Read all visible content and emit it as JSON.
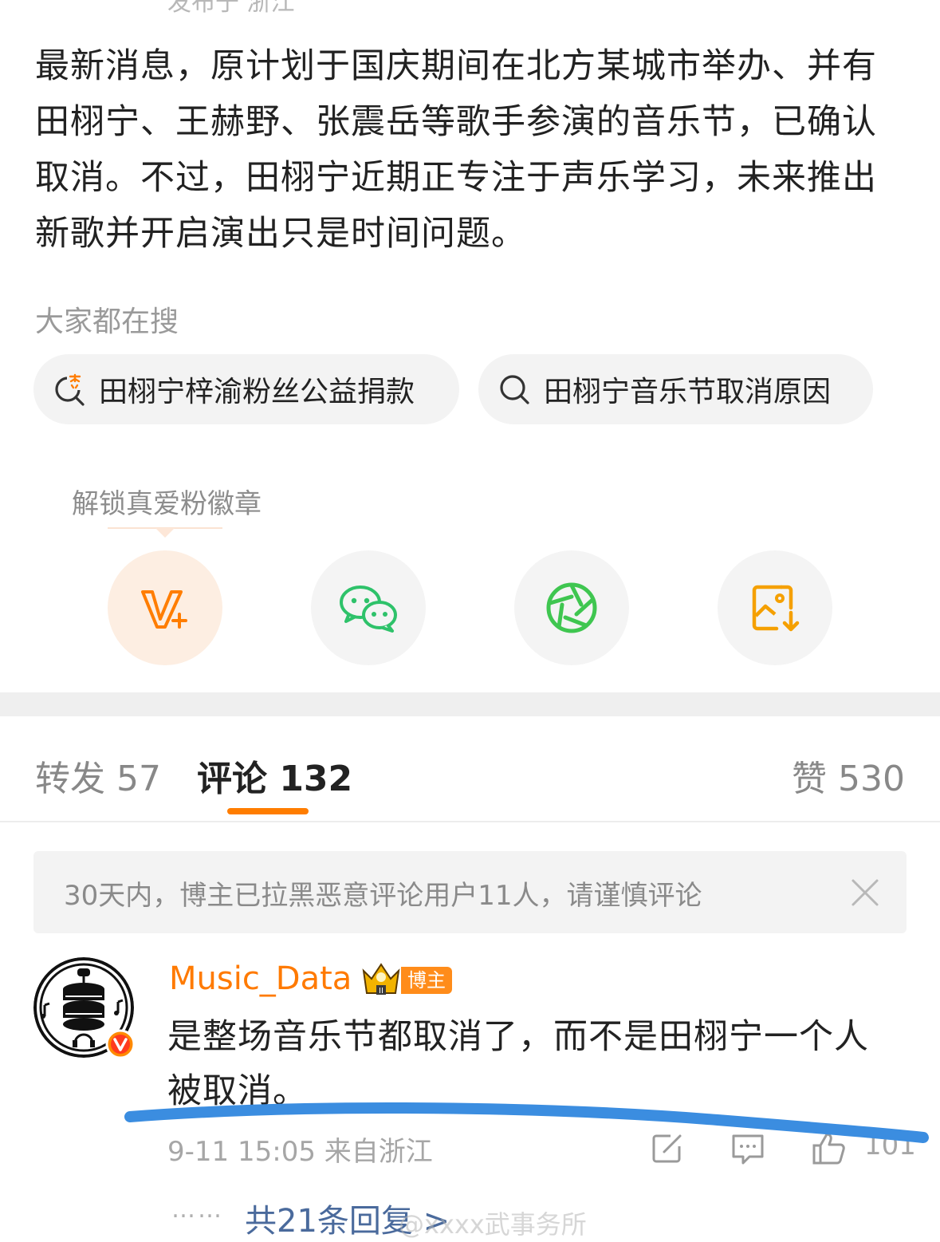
{
  "post": {
    "meta_cropped": "发布于 浙江",
    "body": "最新消息，原计划于国庆期间在北方某城市举办、并有田栩宁、王赫野、张震岳等歌手参演的音乐节，已确认取消。不过，田栩宁近期正专注于声乐学习，未来推出新歌并开启演出只是时间问题。"
  },
  "hot_search": {
    "title": "大家都在搜",
    "items": [
      {
        "label": "田栩宁梓渝粉丝公益捐款",
        "icon": "hot-search-icon"
      },
      {
        "label": "田栩宁音乐节取消原因",
        "icon": "search-icon"
      }
    ]
  },
  "share": {
    "tip": "解锁真爱粉徽章",
    "buttons": [
      {
        "icon": "fan-badge-v-plus-icon",
        "color": "#ff7d00"
      },
      {
        "icon": "wechat-icon",
        "color": "#2ec26a"
      },
      {
        "icon": "moments-aperture-icon",
        "color": "#3fc650"
      },
      {
        "icon": "save-image-icon",
        "color": "#f5a000"
      }
    ]
  },
  "tabs": {
    "repost": "转发 57",
    "comment": "评论 132",
    "like": "赞 530"
  },
  "notice": {
    "text": "30天内，博主已拉黑恶意评论用户11人，请谨慎评论"
  },
  "comment": {
    "username": "Music_Data",
    "author_tag": "博主",
    "text": "是整场音乐节都取消了，而不是田栩宁一个人被取消。",
    "meta": "9-11 15:05 来自浙江",
    "like_count": "101",
    "dots": "……",
    "replies": "共21条回复 >"
  },
  "watermark": "@xxxx武事务所",
  "colors": {
    "accent": "#ff7d00",
    "username": "#ff7a00",
    "reply_link": "#4a6a9c",
    "highlight_stroke": "#3b8de0"
  }
}
